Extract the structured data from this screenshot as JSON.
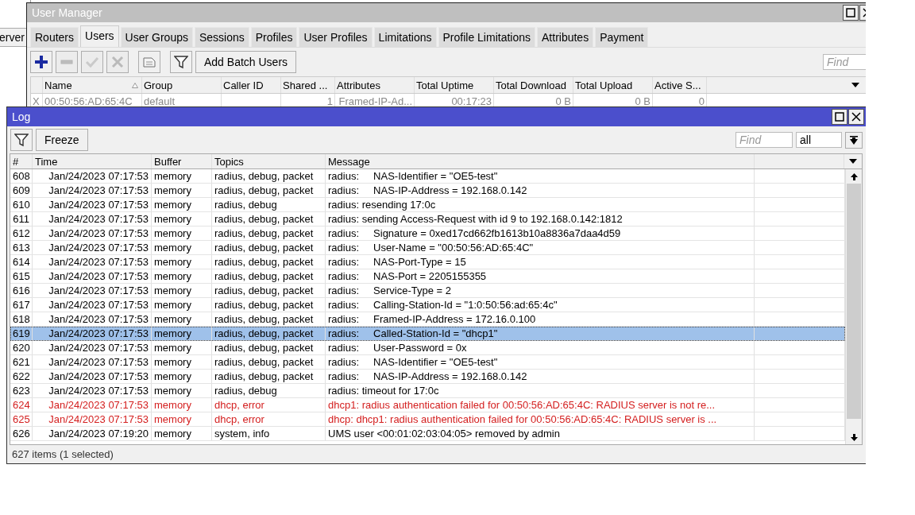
{
  "background_window": {
    "tab_fragment": "erver"
  },
  "user_manager": {
    "title": "User Manager",
    "tabs": [
      {
        "label": "Routers",
        "selected": false
      },
      {
        "label": "Users",
        "selected": true
      },
      {
        "label": "User Groups",
        "selected": false
      },
      {
        "label": "Sessions",
        "selected": false
      },
      {
        "label": "Profiles",
        "selected": false
      },
      {
        "label": "User Profiles",
        "selected": false
      },
      {
        "label": "Limitations",
        "selected": false
      },
      {
        "label": "Profile Limitations",
        "selected": false
      },
      {
        "label": "Attributes",
        "selected": false
      },
      {
        "label": "Payment",
        "selected": false
      }
    ],
    "toolbar": [
      {
        "kind": "add",
        "disabled": false
      },
      {
        "kind": "remove",
        "disabled": true
      },
      {
        "kind": "enable",
        "disabled": true
      },
      {
        "kind": "disable",
        "disabled": true
      },
      {
        "kind": "comment",
        "disabled": false
      },
      {
        "kind": "filter",
        "disabled": false
      }
    ],
    "batch_button": "Add Batch Users",
    "search": {
      "placeholder": "Find"
    },
    "table": {
      "columns": [
        "Name",
        "Group",
        "Caller ID",
        "Shared ...",
        "Attributes",
        "Total Uptime",
        "Total Download",
        "Total Upload",
        "Active S..."
      ],
      "rows": [
        {
          "flag": "X",
          "disabled": true,
          "cells": [
            "00:50:56:AD:65:4C",
            "default",
            "",
            "1",
            "Framed-IP-Ad...",
            "00:17:23",
            "0 B",
            "0 B",
            "0"
          ]
        }
      ]
    }
  },
  "log": {
    "title": "Log",
    "freeze_button": "Freeze",
    "search": {
      "placeholder": "Find"
    },
    "topic_filter": "all",
    "table": {
      "columns": [
        "#",
        "Time",
        "Buffer",
        "Topics",
        "Message"
      ],
      "rows": [
        {
          "cells": [
            "608",
            "Jan/24/2023 07:17:53",
            "memory",
            "radius, debug, packet",
            "radius:     NAS-Identifier = \"OE5-test\""
          ],
          "error": false,
          "selected": false
        },
        {
          "cells": [
            "609",
            "Jan/24/2023 07:17:53",
            "memory",
            "radius, debug, packet",
            "radius:     NAS-IP-Address = 192.168.0.142"
          ],
          "error": false,
          "selected": false
        },
        {
          "cells": [
            "610",
            "Jan/24/2023 07:17:53",
            "memory",
            "radius, debug",
            "radius: resending 17:0c"
          ],
          "error": false,
          "selected": false
        },
        {
          "cells": [
            "611",
            "Jan/24/2023 07:17:53",
            "memory",
            "radius, debug, packet",
            "radius: sending Access-Request with id 9 to 192.168.0.142:1812"
          ],
          "error": false,
          "selected": false
        },
        {
          "cells": [
            "612",
            "Jan/24/2023 07:17:53",
            "memory",
            "radius, debug, packet",
            "radius:     Signature = 0xed17cd662fb1613b10a8836a7daa4d59"
          ],
          "error": false,
          "selected": false
        },
        {
          "cells": [
            "613",
            "Jan/24/2023 07:17:53",
            "memory",
            "radius, debug, packet",
            "radius:     User-Name = \"00:50:56:AD:65:4C\""
          ],
          "error": false,
          "selected": false
        },
        {
          "cells": [
            "614",
            "Jan/24/2023 07:17:53",
            "memory",
            "radius, debug, packet",
            "radius:     NAS-Port-Type = 15"
          ],
          "error": false,
          "selected": false
        },
        {
          "cells": [
            "615",
            "Jan/24/2023 07:17:53",
            "memory",
            "radius, debug, packet",
            "radius:     NAS-Port = 2205155355"
          ],
          "error": false,
          "selected": false
        },
        {
          "cells": [
            "616",
            "Jan/24/2023 07:17:53",
            "memory",
            "radius, debug, packet",
            "radius:     Service-Type = 2"
          ],
          "error": false,
          "selected": false
        },
        {
          "cells": [
            "617",
            "Jan/24/2023 07:17:53",
            "memory",
            "radius, debug, packet",
            "radius:     Calling-Station-Id = \"1:0:50:56:ad:65:4c\""
          ],
          "error": false,
          "selected": false
        },
        {
          "cells": [
            "618",
            "Jan/24/2023 07:17:53",
            "memory",
            "radius, debug, packet",
            "radius:     Framed-IP-Address = 172.16.0.100"
          ],
          "error": false,
          "selected": false
        },
        {
          "cells": [
            "619",
            "Jan/24/2023 07:17:53",
            "memory",
            "radius, debug, packet",
            "radius:     Called-Station-Id = \"dhcp1\""
          ],
          "error": false,
          "selected": true
        },
        {
          "cells": [
            "620",
            "Jan/24/2023 07:17:53",
            "memory",
            "radius, debug, packet",
            "radius:     User-Password = 0x"
          ],
          "error": false,
          "selected": false
        },
        {
          "cells": [
            "621",
            "Jan/24/2023 07:17:53",
            "memory",
            "radius, debug, packet",
            "radius:     NAS-Identifier = \"OE5-test\""
          ],
          "error": false,
          "selected": false
        },
        {
          "cells": [
            "622",
            "Jan/24/2023 07:17:53",
            "memory",
            "radius, debug, packet",
            "radius:     NAS-IP-Address = 192.168.0.142"
          ],
          "error": false,
          "selected": false
        },
        {
          "cells": [
            "623",
            "Jan/24/2023 07:17:53",
            "memory",
            "radius, debug",
            "radius: timeout for 17:0c"
          ],
          "error": false,
          "selected": false
        },
        {
          "cells": [
            "624",
            "Jan/24/2023 07:17:53",
            "memory",
            "dhcp, error",
            "dhcp1: radius authentication failed for 00:50:56:AD:65:4C: RADIUS server is not re..."
          ],
          "error": true,
          "selected": false
        },
        {
          "cells": [
            "625",
            "Jan/24/2023 07:17:53",
            "memory",
            "dhcp, error",
            "dhcp: dhcp1: radius authentication failed for 00:50:56:AD:65:4C: RADIUS server is ..."
          ],
          "error": true,
          "selected": false
        },
        {
          "cells": [
            "626",
            "Jan/24/2023 07:19:20",
            "memory",
            "system, info",
            "UMS user <00:01:02:03:04:05> removed by admin"
          ],
          "error": false,
          "selected": false
        }
      ]
    },
    "status_bar": "627 items (1 selected)"
  }
}
